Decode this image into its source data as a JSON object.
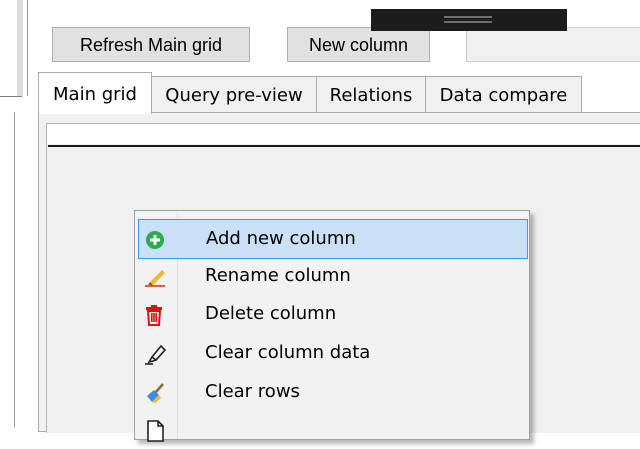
{
  "toolbar": {
    "refresh_label": "Refresh Main grid",
    "new_column_label": "New column"
  },
  "tabs": [
    {
      "label": "Main grid",
      "active": true
    },
    {
      "label": "Query pre-view",
      "active": false
    },
    {
      "label": "Relations",
      "active": false
    },
    {
      "label": "Data compare",
      "active": false
    }
  ],
  "context_menu": {
    "items": [
      {
        "label": "Add new column",
        "icon": "plus-circle-icon",
        "highlighted": true
      },
      {
        "label": "Rename column",
        "icon": "pencil-icon",
        "highlighted": false
      },
      {
        "label": "Delete column",
        "icon": "trash-icon",
        "highlighted": false
      },
      {
        "label": "Clear column data",
        "icon": "highlighter-icon",
        "highlighted": false
      },
      {
        "label": "Clear rows",
        "icon": "broom-icon",
        "highlighted": false
      },
      {
        "label": "",
        "icon": "document-icon",
        "highlighted": false
      }
    ]
  },
  "colors": {
    "highlight_fill": "#c9e0f7",
    "highlight_border": "#3399ff",
    "add_icon": "#2eab4f",
    "delete_icon": "#e01010"
  }
}
